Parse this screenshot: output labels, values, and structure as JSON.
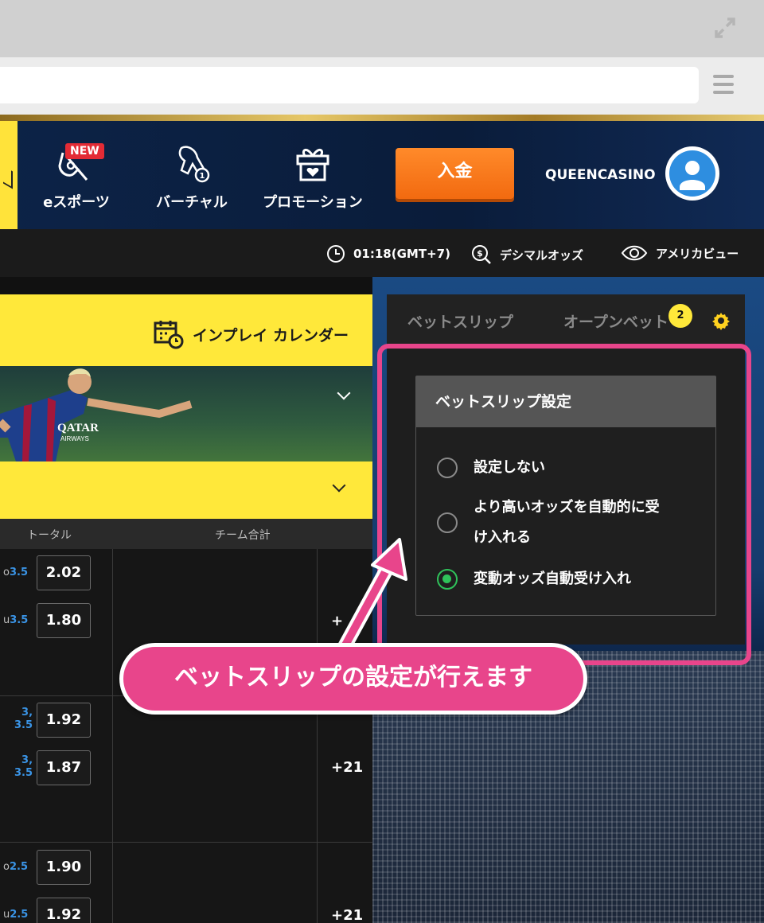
{
  "header": {
    "nav": [
      {
        "label": "eスポーツ",
        "icon": "esports-icon",
        "badge": "NEW"
      },
      {
        "label": "バーチャル",
        "icon": "horse-icon"
      },
      {
        "label": "プロモーション",
        "icon": "gift-icon"
      }
    ],
    "deposit_label": "入金",
    "username": "QUEENCASINO",
    "avatar_icon": "user-icon"
  },
  "info_bar": {
    "time": "01:18(GMT+7)",
    "odds_format": "デシマルオッズ",
    "view_mode": "アメリカビュー"
  },
  "main": {
    "calendar_label": "インプレイ カレンダー",
    "columns": [
      "トータル",
      "チーム合計"
    ],
    "rows": [
      {
        "lines": [
          {
            "prefix": "o",
            "value": "3.5",
            "odds": "2.02"
          },
          {
            "prefix": "u",
            "value": "3.5",
            "odds": "1.80"
          }
        ],
        "more": "+"
      },
      {
        "lines": [
          {
            "prefix": "",
            "value": "3,\n3.5",
            "odds": "1.92"
          },
          {
            "prefix": "",
            "value": "3,\n3.5",
            "odds": "1.87"
          }
        ],
        "more": "+21"
      },
      {
        "lines": [
          {
            "prefix": "o",
            "value": "2.5",
            "odds": "1.90"
          },
          {
            "prefix": "u",
            "value": "2.5",
            "odds": "1.92"
          }
        ],
        "more": "+21"
      }
    ]
  },
  "betslip": {
    "tabs": [
      "ベットスリップ",
      "オープンベット"
    ],
    "open_bets_count": "2",
    "settings_title": "ベットスリップ設定",
    "options": [
      {
        "label": "設定しない",
        "selected": false
      },
      {
        "label": "より高いオッズを自動的に受\nけ入れる",
        "selected": false
      },
      {
        "label": "変動オッズ自動受け入れ",
        "selected": true
      }
    ]
  },
  "callout_text": "ベットスリップの設定が行えます",
  "colors": {
    "accent_yellow": "#ffe83a",
    "deposit_orange": "#f26a10",
    "callout_pink": "#e8458b",
    "radio_green": "#2fc25a",
    "header_navy": "#0c2347"
  }
}
